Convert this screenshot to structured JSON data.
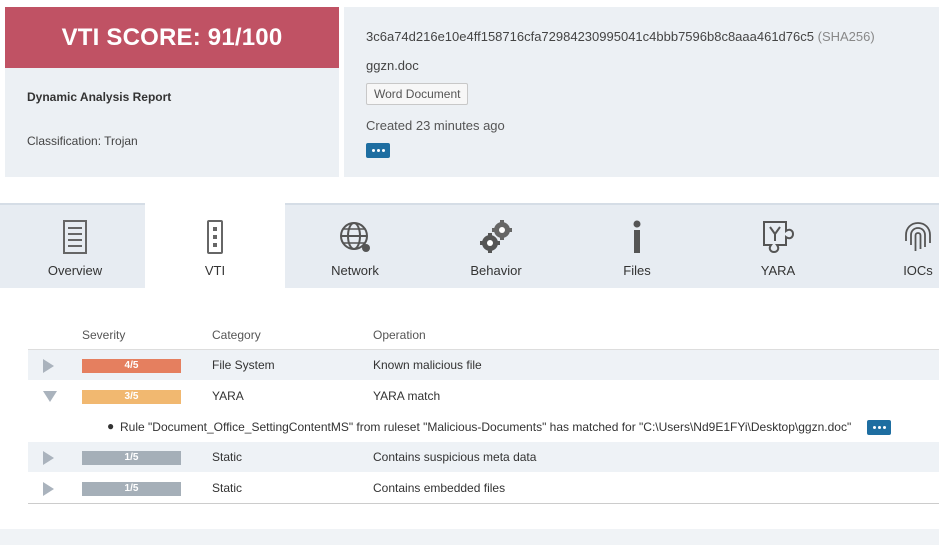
{
  "summary": {
    "score_text": "VTI SCORE: 91/100",
    "report_title": "Dynamic Analysis Report",
    "classification": "Classification: Trojan",
    "score_color": "#c05264"
  },
  "file": {
    "hash": "3c6a74d216e10e4ff158716cfa72984230995041c4bbb7596b8c8aaa461d76c5",
    "hash_type": "(SHA256)",
    "name": "ggzn.doc",
    "type_badge": "Word Document",
    "created": "Created 23 minutes ago"
  },
  "tabs": [
    {
      "label": "Overview",
      "icon": "document-icon",
      "active": false
    },
    {
      "label": "VTI",
      "icon": "vti-icon",
      "active": true
    },
    {
      "label": "Network",
      "icon": "globe-network-icon",
      "active": false
    },
    {
      "label": "Behavior",
      "icon": "gears-icon",
      "active": false
    },
    {
      "label": "Files",
      "icon": "info-icon",
      "active": false
    },
    {
      "label": "YARA",
      "icon": "yara-puzzle-icon",
      "active": false
    },
    {
      "label": "IOCs",
      "icon": "fingerprint-icon",
      "active": false
    }
  ],
  "table": {
    "headers": {
      "severity": "Severity",
      "category": "Category",
      "operation": "Operation"
    },
    "rows": [
      {
        "severity": "4/5",
        "severity_color": "#e57f5f",
        "category": "File System",
        "operation": "Known malicious file",
        "expanded": false
      },
      {
        "severity": "3/5",
        "severity_color": "#f1b870",
        "category": "YARA",
        "operation": "YARA match",
        "expanded": true,
        "detail": "Rule \"Document_Office_SettingContentMS\" from ruleset \"Malicious-Documents\" has matched for \"C:\\Users\\Nd9E1FYi\\Desktop\\ggzn.doc\""
      },
      {
        "severity": "1/5",
        "severity_color": "#a5afb8",
        "category": "Static",
        "operation": "Contains suspicious meta data",
        "expanded": false
      },
      {
        "severity": "1/5",
        "severity_color": "#a5afb8",
        "category": "Static",
        "operation": "Contains embedded files",
        "expanded": false
      }
    ]
  }
}
